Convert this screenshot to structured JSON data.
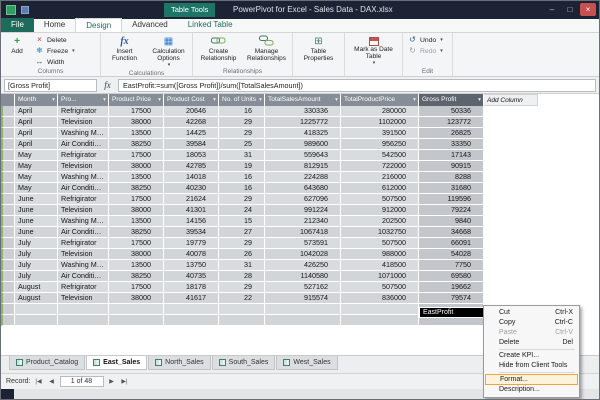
{
  "title_bar": {
    "table_tools": "Table Tools",
    "title": "PowerPivot for Excel - Sales Data - DAX.xlsx",
    "minimize": "–",
    "maximize": "□",
    "close": "×"
  },
  "colors": {
    "accent_teal": "#1d7567",
    "close_red": "#c75050",
    "highlight_orange": "#eda63c",
    "selected_header": "#5d646e"
  },
  "ribbon": {
    "tabs": {
      "file": "File",
      "home": "Home",
      "design": "Design",
      "advanced": "Advanced",
      "contextual": "Linked Table"
    },
    "active_tab": "Design",
    "columns_group": {
      "label": "Columns",
      "add": "Add",
      "delete": "Delete",
      "freeze": "Freeze",
      "width": "Width"
    },
    "calculations_group": {
      "label": "Calculations",
      "insert_function": "Insert Function",
      "calculation_options": "Calculation Options"
    },
    "relationships_group": {
      "label": "Relationships",
      "create_relationship": "Create Relationship",
      "manage_relationships": "Manage Relationships"
    },
    "table_properties": "Table Properties",
    "mark_as_date_table": "Mark as Date Table",
    "edit_group": {
      "label": "Edit",
      "undo": "Undo",
      "redo": "Redo"
    }
  },
  "formula_bar": {
    "name_box": "[Gross Profit]",
    "fx": "fx",
    "formula": "EastProfit:=sum([Gross Profit])/sum([TotalSalesAmount])"
  },
  "grid": {
    "columns": [
      "Month",
      "Pro...",
      "Product Price",
      "Product Cost",
      "No. of Units",
      "TotalSalesAmount",
      "TotalProductPrice",
      "Gross Profit"
    ],
    "selected_column": "Gross Profit",
    "add_column_label": "Add Column",
    "measure_cell": "EastProfit",
    "rows": [
      [
        "April",
        "Refrigirator",
        "17500",
        "20646",
        "16",
        "330336",
        "280000",
        "50336"
      ],
      [
        "April",
        "Television",
        "38000",
        "42268",
        "29",
        "1225772",
        "1102000",
        "123772"
      ],
      [
        "April",
        "Washing Machine",
        "13500",
        "14425",
        "29",
        "418325",
        "391500",
        "26825"
      ],
      [
        "April",
        "Air Conditioner",
        "38250",
        "39584",
        "25",
        "989600",
        "956250",
        "33350"
      ],
      [
        "May",
        "Refrigirator",
        "17500",
        "18053",
        "31",
        "559643",
        "542500",
        "17143"
      ],
      [
        "May",
        "Television",
        "38000",
        "42785",
        "19",
        "812915",
        "722000",
        "90915"
      ],
      [
        "May",
        "Washing Machine",
        "13500",
        "14018",
        "16",
        "224288",
        "216000",
        "8288"
      ],
      [
        "May",
        "Air Conditioner",
        "38250",
        "40230",
        "16",
        "643680",
        "612000",
        "31680"
      ],
      [
        "June",
        "Refrigirator",
        "17500",
        "21624",
        "29",
        "627096",
        "507500",
        "119596"
      ],
      [
        "June",
        "Television",
        "38000",
        "41301",
        "24",
        "991224",
        "912000",
        "79224"
      ],
      [
        "June",
        "Washing Machine",
        "13500",
        "14156",
        "15",
        "212340",
        "202500",
        "9840"
      ],
      [
        "June",
        "Air Conditioner",
        "38250",
        "39534",
        "27",
        "1067418",
        "1032750",
        "34668"
      ],
      [
        "July",
        "Refrigirator",
        "17500",
        "19779",
        "29",
        "573591",
        "507500",
        "66091"
      ],
      [
        "July",
        "Television",
        "38000",
        "40078",
        "26",
        "1042028",
        "988000",
        "54028"
      ],
      [
        "July",
        "Washing Machine",
        "13500",
        "13750",
        "31",
        "426250",
        "418500",
        "7750"
      ],
      [
        "July",
        "Air Conditioner",
        "38250",
        "40735",
        "28",
        "1140580",
        "1071000",
        "69580"
      ],
      [
        "August",
        "Refrigirator",
        "17500",
        "18178",
        "29",
        "527162",
        "507500",
        "19662"
      ],
      [
        "August",
        "Television",
        "38000",
        "41617",
        "22",
        "915574",
        "836000",
        "79574"
      ]
    ]
  },
  "context_menu": {
    "items": [
      {
        "label": "Cut",
        "shortcut": "Ctrl-X"
      },
      {
        "label": "Copy",
        "shortcut": "Ctrl-C"
      },
      {
        "label": "Paste",
        "shortcut": "Ctrl-V",
        "disabled": true
      },
      {
        "label": "Delete",
        "shortcut": "Del"
      },
      {
        "type": "separator"
      },
      {
        "label": "Create KPI..."
      },
      {
        "label": "Hide from Client Tools"
      },
      {
        "type": "separator"
      },
      {
        "label": "Format...",
        "highlighted": true
      },
      {
        "label": "Description..."
      }
    ]
  },
  "sheet_tabs": {
    "tabs": [
      "Product_Catalog",
      "East_Sales",
      "North_Sales",
      "South_Sales",
      "West_Sales"
    ],
    "active_index": 1
  },
  "status_bar": {
    "record_label": "Record:",
    "record_value": "1 of 48",
    "nav": {
      "first": "|◀",
      "prev": "◀",
      "next": "▶",
      "last": "▶|"
    }
  }
}
